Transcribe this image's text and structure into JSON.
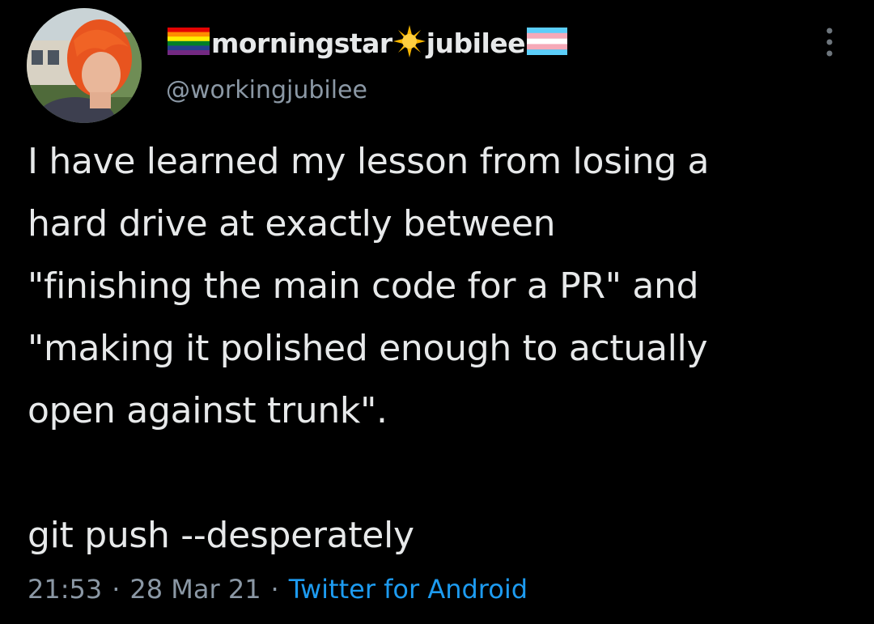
{
  "user": {
    "name_part1": "morningstar",
    "name_part2": "jubilee",
    "handle": "@workingjubilee",
    "name_emoji": [
      "rainbow-flag-icon",
      "sun-icon",
      "trans-flag-icon"
    ]
  },
  "tweet": {
    "lines": [
      "I have learned my lesson from losing a",
      "hard drive at exactly between",
      "\"finishing the main code for a PR\" and",
      "\"making it polished enough to actually",
      "open against trunk\".",
      "",
      "git push --desperately"
    ],
    "time": "21:53",
    "date": "28 Mar 21",
    "separator": "·",
    "source": "Twitter for Android"
  },
  "colors": {
    "background": "#000000",
    "text": "#e7e9ea",
    "secondary": "#8b98a5",
    "link": "#1d9bf0"
  }
}
